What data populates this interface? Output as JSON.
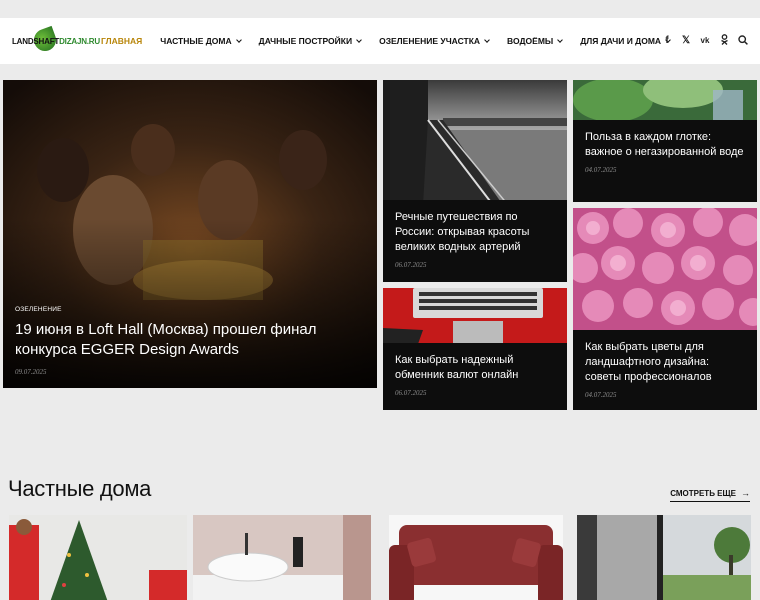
{
  "logo": {
    "text_main": "LANDSHAFT",
    "text_accent": "DIZAJN.RU"
  },
  "nav": [
    {
      "label": "Главная",
      "has_dropdown": false,
      "active": true
    },
    {
      "label": "Частные дома",
      "has_dropdown": true
    },
    {
      "label": "Дачные постройки",
      "has_dropdown": true
    },
    {
      "label": "Озеленение участка",
      "has_dropdown": true
    },
    {
      "label": "Водоёмы",
      "has_dropdown": true
    },
    {
      "label": "Для дачи и дома",
      "has_dropdown": true
    }
  ],
  "header_icons": [
    "facebook-icon",
    "x-twitter-icon",
    "vk-icon",
    "odnoklassniki-icon",
    "search-icon"
  ],
  "featured": {
    "main": {
      "category": "Озеленение",
      "title": "19 июня в Loft Hall (Москва) прошел финал конкурса EGGER Design Awards",
      "date": "09.07.2025"
    },
    "items": [
      {
        "title": "Речные путешествия по России: открывая красоты великих водных артерий",
        "date": "06.07.2025"
      },
      {
        "title": "Польза в каждом глотке: важное о негазированной воде",
        "date": "04.07.2025"
      },
      {
        "title": "Как выбрать надежный обменник валют онлайн",
        "date": "06.07.2025"
      },
      {
        "title": "Как выбрать цветы для ландшафтного дизайна: советы профессионалов",
        "date": "04.07.2025"
      }
    ]
  },
  "section": {
    "title": "Частные дома",
    "more_label": "СМОТРЕТЬ ЕЩЕ"
  },
  "colors": {
    "accent": "#b8860b",
    "caption_bg": "#0d0d0d",
    "page_bg": "#ebebeb"
  }
}
